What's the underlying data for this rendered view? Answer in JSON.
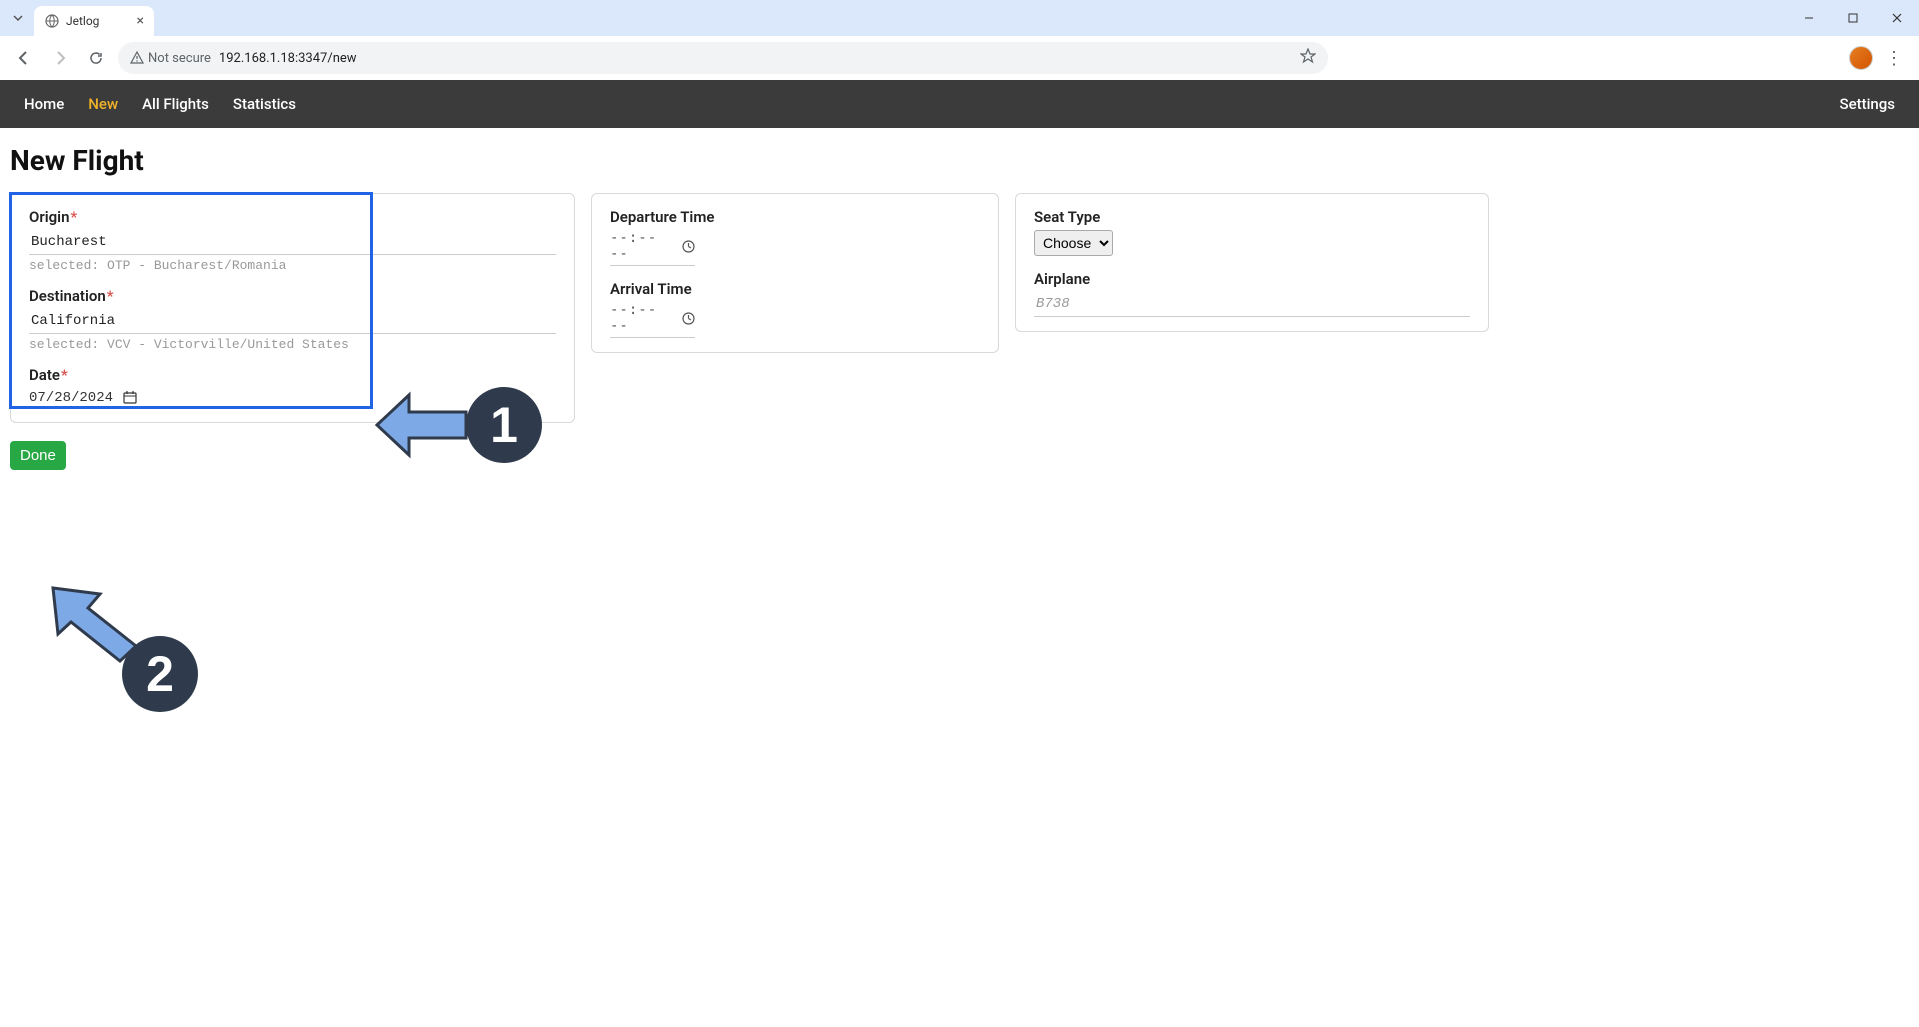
{
  "browser": {
    "tab_title": "Jetlog",
    "security_text": "Not secure",
    "url": "192.168.1.18:3347/new"
  },
  "nav": {
    "home": "Home",
    "new": "New",
    "all_flights": "All Flights",
    "statistics": "Statistics",
    "settings": "Settings"
  },
  "page": {
    "title": "New Flight",
    "done": "Done"
  },
  "fields": {
    "origin_label": "Origin",
    "origin_value": "Bucharest",
    "origin_hint": "selected: OTP - Bucharest/Romania",
    "destination_label": "Destination",
    "destination_value": "California",
    "destination_hint": "selected: VCV - Victorville/United States",
    "date_label": "Date",
    "date_value": "07/28/2024",
    "departure_label": "Departure Time",
    "departure_value": "--:-- --",
    "arrival_label": "Arrival Time",
    "arrival_value": "--:-- --",
    "seat_label": "Seat Type",
    "seat_value": "Choose",
    "airplane_label": "Airplane",
    "airplane_placeholder": "B738"
  },
  "annotations": {
    "one": "1",
    "two": "2"
  }
}
